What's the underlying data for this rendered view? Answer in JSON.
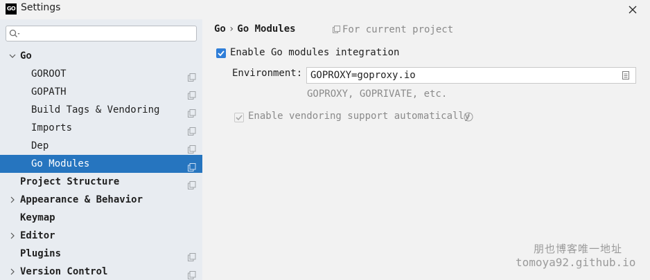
{
  "window": {
    "app_icon_text": "GO",
    "title": "Settings"
  },
  "search": {
    "placeholder": ""
  },
  "tree": [
    {
      "label": "Go",
      "bold": true,
      "expanded": true
    },
    {
      "label": "GOROOT",
      "copy": true
    },
    {
      "label": "GOPATH",
      "copy": true
    },
    {
      "label": "Build Tags & Vendoring",
      "copy": true
    },
    {
      "label": "Imports",
      "copy": true
    },
    {
      "label": "Dep",
      "copy": true
    },
    {
      "label": "Go Modules",
      "copy": true,
      "selected": true
    },
    {
      "label": "Project Structure",
      "bold": true,
      "copy": true
    },
    {
      "label": "Appearance & Behavior",
      "bold": true,
      "collapsed": true
    },
    {
      "label": "Keymap",
      "bold": true
    },
    {
      "label": "Editor",
      "bold": true,
      "collapsed": true
    },
    {
      "label": "Plugins",
      "bold": true,
      "copy": true
    },
    {
      "label": "Version Control",
      "bold": true,
      "collapsed": true,
      "copy": true
    }
  ],
  "breadcrumb": {
    "parent": "Go",
    "separator": "›",
    "current": "Go Modules"
  },
  "scope": {
    "label": "For current project"
  },
  "modules": {
    "enable_label": "Enable Go modules integration",
    "enable_checked": true,
    "env_label": "Environment:",
    "env_value": "GOPROXY=goproxy.io",
    "env_hint": "GOPROXY, GOPRIVATE, etc.",
    "vendoring_label": "Enable vendoring support automatically",
    "vendoring_checked": true,
    "vendoring_disabled": true
  },
  "watermark": {
    "line1": "朋也博客唯一地址",
    "line2": "tomoya92.github.io"
  },
  "colors": {
    "selection": "#2675bf",
    "checkbox": "#2f7ed8",
    "sidebar": "#e8ecf1",
    "panel": "#f2f2f2"
  }
}
